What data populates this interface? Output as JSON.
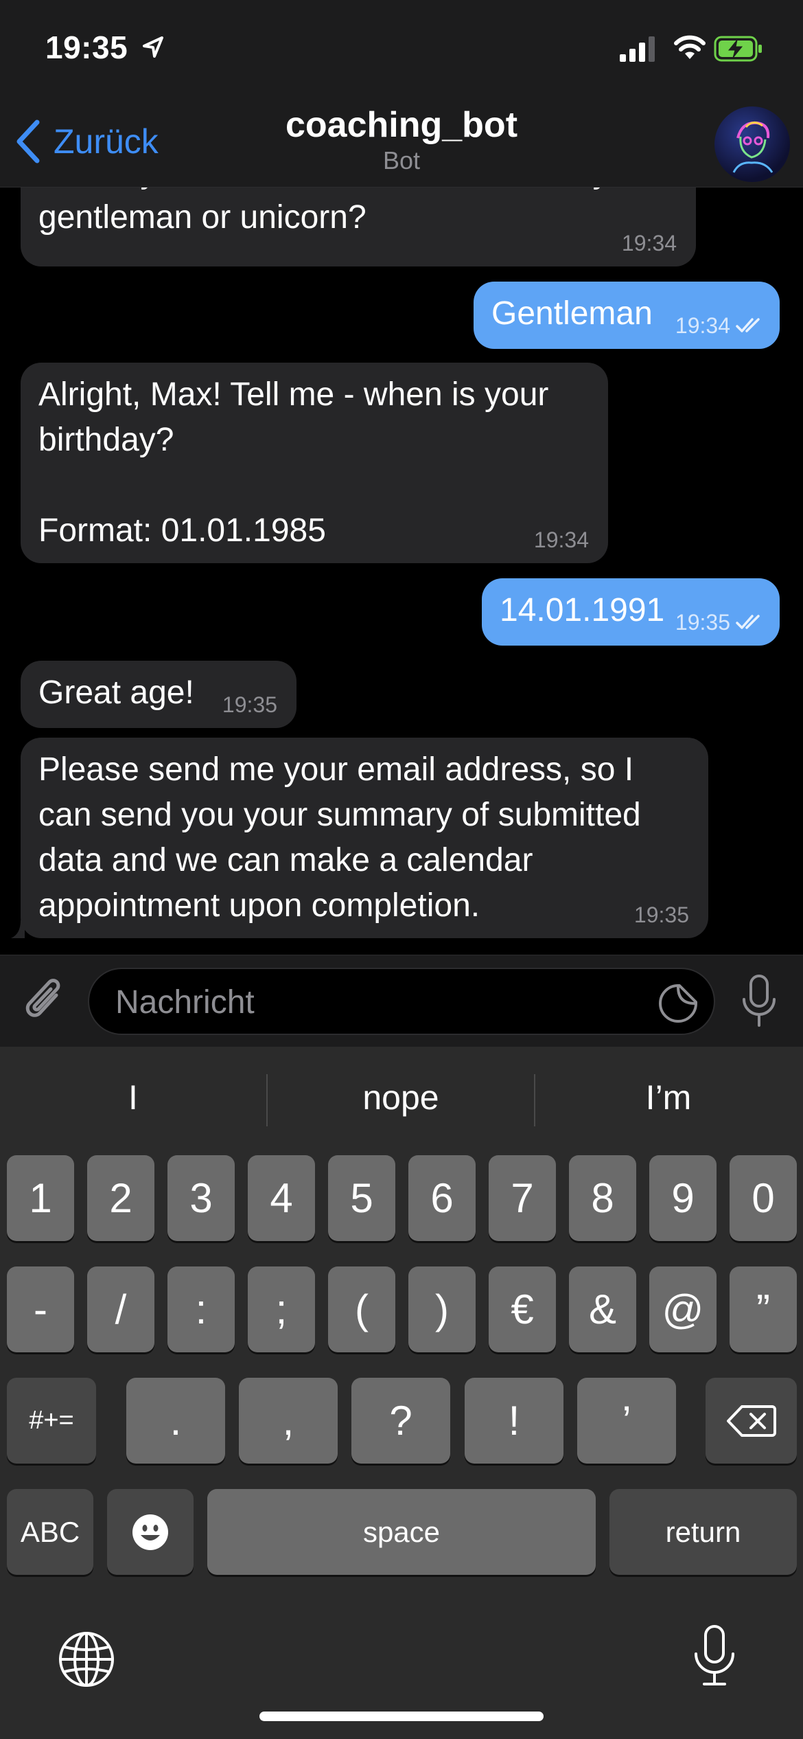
{
  "status_bar": {
    "time": "19:35"
  },
  "header": {
    "back_label": "Zurück",
    "title": "coaching_bot",
    "subtitle": "Bot"
  },
  "messages": [
    {
      "side": "in",
      "text": "Would you like to be referred to as lady,\ngentleman or unicorn?",
      "time": "19:34"
    },
    {
      "side": "out",
      "text": "Gentleman",
      "time": "19:34",
      "read": true
    },
    {
      "side": "in",
      "text": "Alright, Max! Tell me - when is your\nbirthday?\n\nFormat: 01.01.1985",
      "time": "19:34"
    },
    {
      "side": "out",
      "text": "14.01.1991",
      "time": "19:35",
      "read": true
    },
    {
      "side": "in",
      "text": "Great age!",
      "time": "19:35"
    },
    {
      "side": "in",
      "text": "Please send me your email address, so I\ncan send you your summary of submitted\ndata and we can make a calendar\nappointment upon completion.",
      "time": "19:35"
    }
  ],
  "composer": {
    "placeholder": "Nachricht"
  },
  "keyboard": {
    "suggestions": [
      "I",
      "nope",
      "I’m"
    ],
    "row1": [
      "1",
      "2",
      "3",
      "4",
      "5",
      "6",
      "7",
      "8",
      "9",
      "0"
    ],
    "row2": [
      "-",
      "/",
      ":",
      ";",
      "(",
      ")",
      "€",
      "&",
      "@",
      "”"
    ],
    "row3": {
      "mode": "#+=",
      "keys": [
        ".",
        ",",
        "?",
        "!",
        "’"
      ]
    },
    "row4": {
      "abc": "ABC",
      "space": "space",
      "return": "return"
    }
  },
  "colors": {
    "accent": "#3e8df5",
    "outgoing_bubble": "#5ea4f5",
    "incoming_bubble": "#262628",
    "keyboard_bg": "#2b2b2b",
    "key_bg": "#6b6b6b",
    "key_dark_bg": "#464646"
  }
}
